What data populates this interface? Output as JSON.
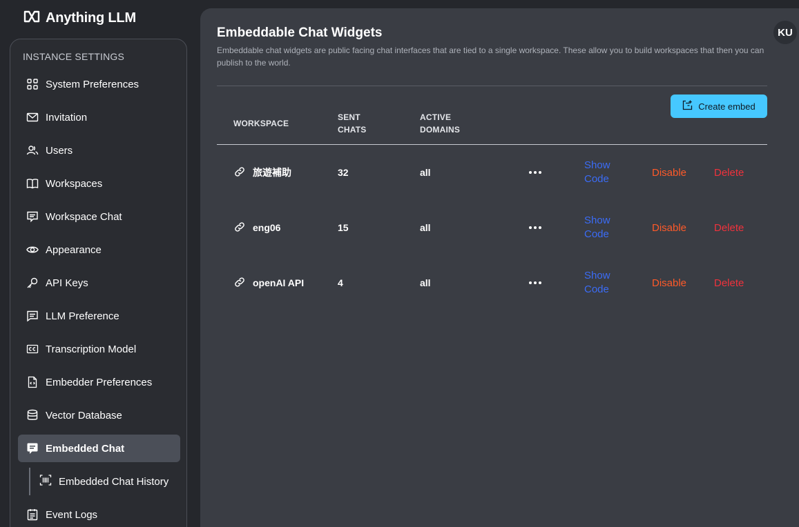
{
  "app": {
    "brand": "Anything LLM"
  },
  "sidebar": {
    "heading": "INSTANCE SETTINGS",
    "items": [
      {
        "label": "System Preferences",
        "icon": "grid-icon"
      },
      {
        "label": "Invitation",
        "icon": "envelope-icon"
      },
      {
        "label": "Users",
        "icon": "users-icon"
      },
      {
        "label": "Workspaces",
        "icon": "book-icon"
      },
      {
        "label": "Workspace Chat",
        "icon": "chat-icon"
      },
      {
        "label": "Appearance",
        "icon": "eye-icon"
      },
      {
        "label": "API Keys",
        "icon": "key-icon"
      },
      {
        "label": "LLM Preference",
        "icon": "message-icon"
      },
      {
        "label": "Transcription Model",
        "icon": "cc-icon"
      },
      {
        "label": "Embedder Preferences",
        "icon": "file-code-icon"
      },
      {
        "label": "Vector Database",
        "icon": "database-icon"
      },
      {
        "label": "Embedded Chat",
        "icon": "embed-icon",
        "active": true
      },
      {
        "label": "Event Logs",
        "icon": "clipboard-icon"
      }
    ],
    "subitems": [
      {
        "label": "Embedded Chat History",
        "icon": "barcode-icon"
      }
    ]
  },
  "header": {
    "title": "Embeddable Chat Widgets",
    "description": "Embeddable chat widgets are public facing chat interfaces that are tied to a single workspace. These allow you to build workspaces that then you can publish to the world.",
    "create_label": "Create embed",
    "avatar": "KU"
  },
  "table": {
    "columns": {
      "workspace": "WORKSPACE",
      "sent_chats_1": "SENT",
      "sent_chats_2": "CHATS",
      "active_domains_1": "ACTIVE",
      "active_domains_2": "DOMAINS"
    },
    "actions": {
      "show_1": "Show",
      "show_2": "Code",
      "disable": "Disable",
      "delete": "Delete"
    },
    "rows": [
      {
        "workspace": "旅遊補助",
        "sent_chats": "32",
        "domains": "all"
      },
      {
        "workspace": "eng06",
        "sent_chats": "15",
        "domains": "all"
      },
      {
        "workspace": "openAI API",
        "sent_chats": "4",
        "domains": "all"
      }
    ]
  },
  "colors": {
    "accent": "#46c8ff",
    "link": "#3b6cf6",
    "disable": "#ff5a29",
    "delete": "#f0323c"
  }
}
